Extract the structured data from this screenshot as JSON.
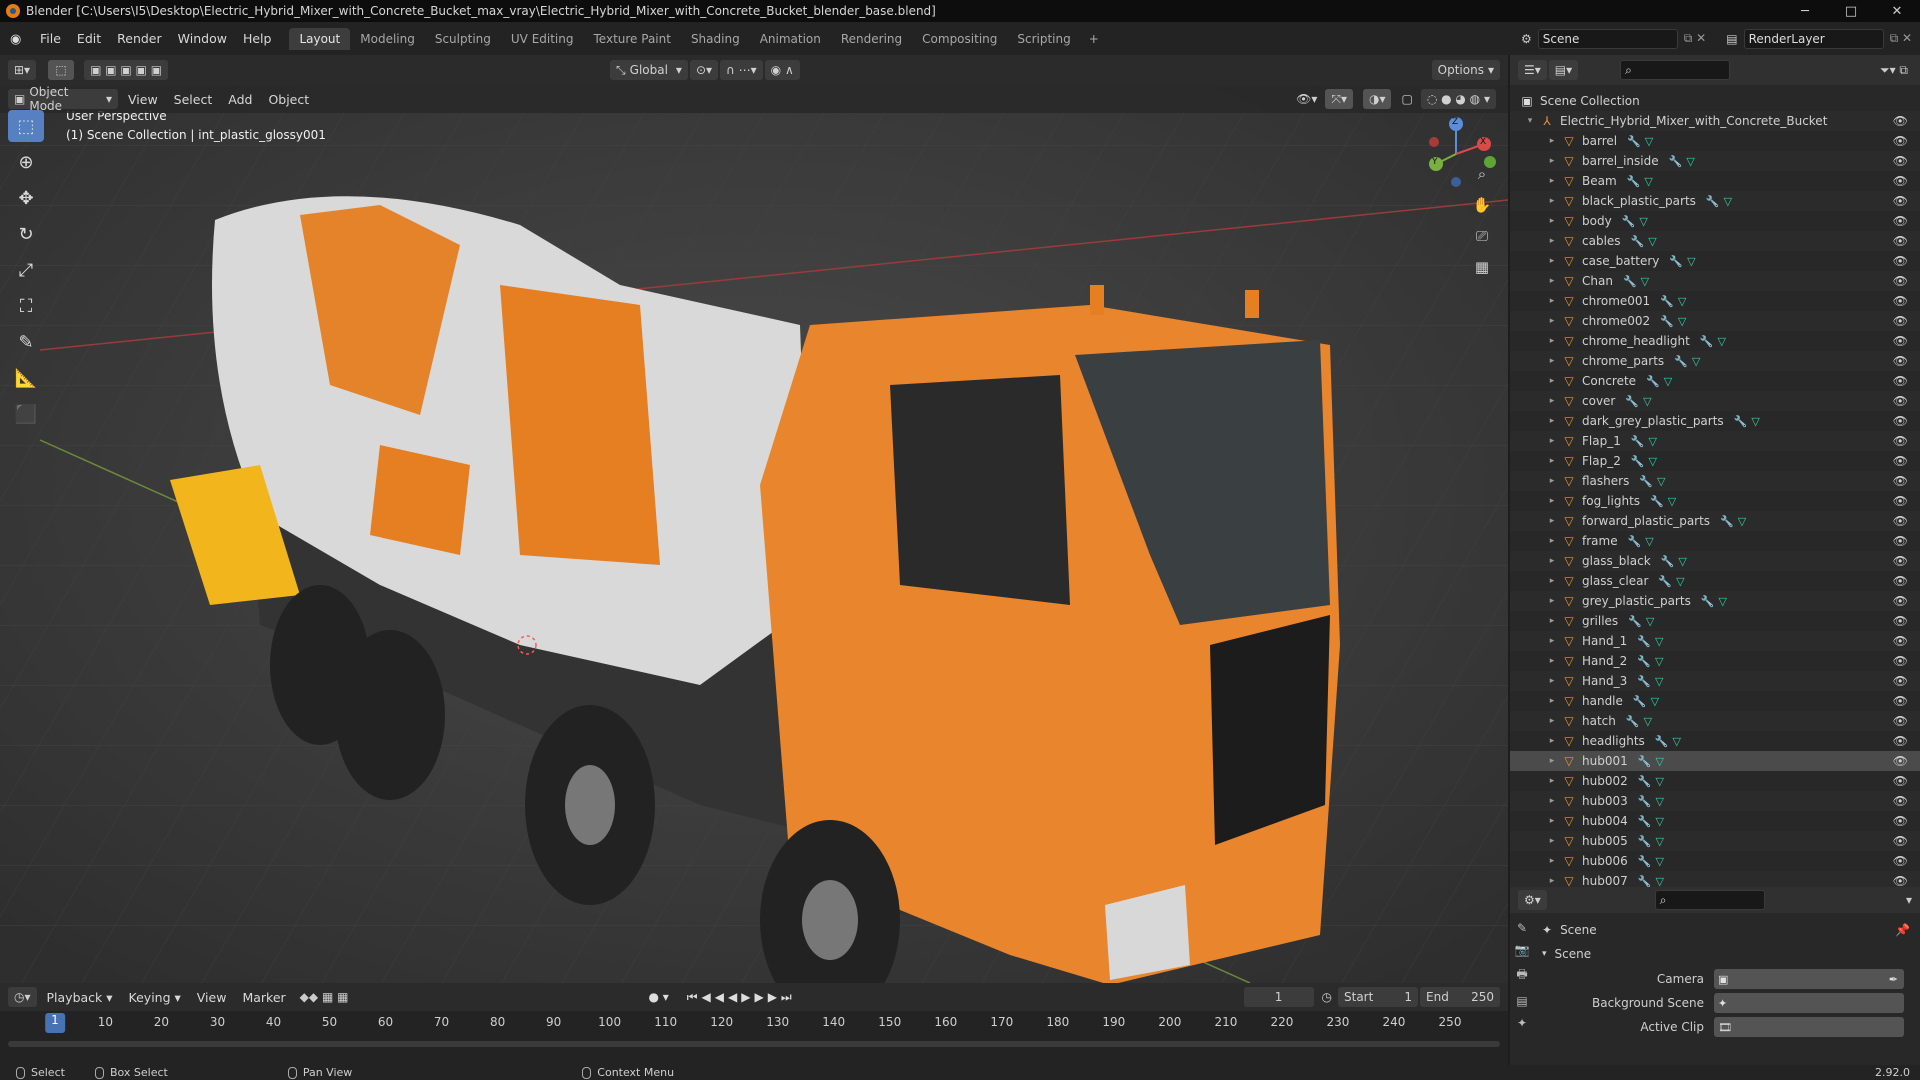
{
  "window": {
    "title": "Blender [C:\\Users\\I5\\Desktop\\Electric_Hybrid_Mixer_with_Concrete_Bucket_max_vray\\Electric_Hybrid_Mixer_with_Concrete_Bucket_blender_base.blend]",
    "minimize": "─",
    "maximize": "□",
    "close": "✕"
  },
  "menu": [
    "File",
    "Edit",
    "Render",
    "Window",
    "Help"
  ],
  "workspaces": [
    "Layout",
    "Modeling",
    "Sculpting",
    "UV Editing",
    "Texture Paint",
    "Shading",
    "Animation",
    "Rendering",
    "Compositing",
    "Scripting"
  ],
  "workspace_add": "+",
  "scene": {
    "name": "Scene",
    "view_layer": "RenderLayer"
  },
  "tool_header": {
    "orientation": "Global",
    "options": "Options"
  },
  "viewport_header": {
    "mode": "Object Mode",
    "menus": [
      "View",
      "Select",
      "Add",
      "Object"
    ]
  },
  "viewport": {
    "perspective": "User Perspective",
    "collection_info": "(1) Scene Collection | int_plastic_glossy001"
  },
  "gizmo": {
    "x": "X",
    "y": "Y",
    "z": "Z"
  },
  "outliner": {
    "root": "Scene Collection",
    "collection": "Electric_Hybrid_Mixer_with_Concrete_Bucket",
    "items": [
      "barrel",
      "barrel_inside",
      "Beam",
      "black_plastic_parts",
      "body",
      "cables",
      "case_battery",
      "Chan",
      "chrome001",
      "chrome002",
      "chrome_headlight",
      "chrome_parts",
      "Concrete",
      "cover",
      "dark_grey_plastic_parts",
      "Flap_1",
      "Flap_2",
      "flashers",
      "fog_lights",
      "forward_plastic_parts",
      "frame",
      "glass_black",
      "glass_clear",
      "grey_plastic_parts",
      "grilles",
      "Hand_1",
      "Hand_2",
      "Hand_3",
      "handle",
      "hatch",
      "headlights",
      "hub001",
      "hub002",
      "hub003",
      "hub004",
      "hub005",
      "hub006",
      "hub007"
    ],
    "selected": "hub001"
  },
  "properties": {
    "breadcrumb": "Scene",
    "panel": "Scene",
    "fields": [
      {
        "label": "Camera",
        "value": ""
      },
      {
        "label": "Background Scene",
        "value": ""
      },
      {
        "label": "Active Clip",
        "value": ""
      }
    ]
  },
  "timeline": {
    "menus": [
      "Playback",
      "Keying",
      "View",
      "Marker"
    ],
    "current_frame": "1",
    "start_label": "Start",
    "start": "1",
    "end_label": "End",
    "end": "250",
    "ticks": [
      "1",
      "10",
      "20",
      "30",
      "40",
      "50",
      "60",
      "70",
      "80",
      "90",
      "100",
      "110",
      "120",
      "130",
      "140",
      "150",
      "160",
      "170",
      "180",
      "190",
      "200",
      "210",
      "220",
      "230",
      "240",
      "250"
    ]
  },
  "status": {
    "select": "Select",
    "box_select": "Box Select",
    "pan_view": "Pan View",
    "context_menu": "Context Menu",
    "version": "2.92.0"
  },
  "colors": {
    "accent": "#4772b3",
    "orange": "#e8952f",
    "truck": "#e67e22"
  }
}
